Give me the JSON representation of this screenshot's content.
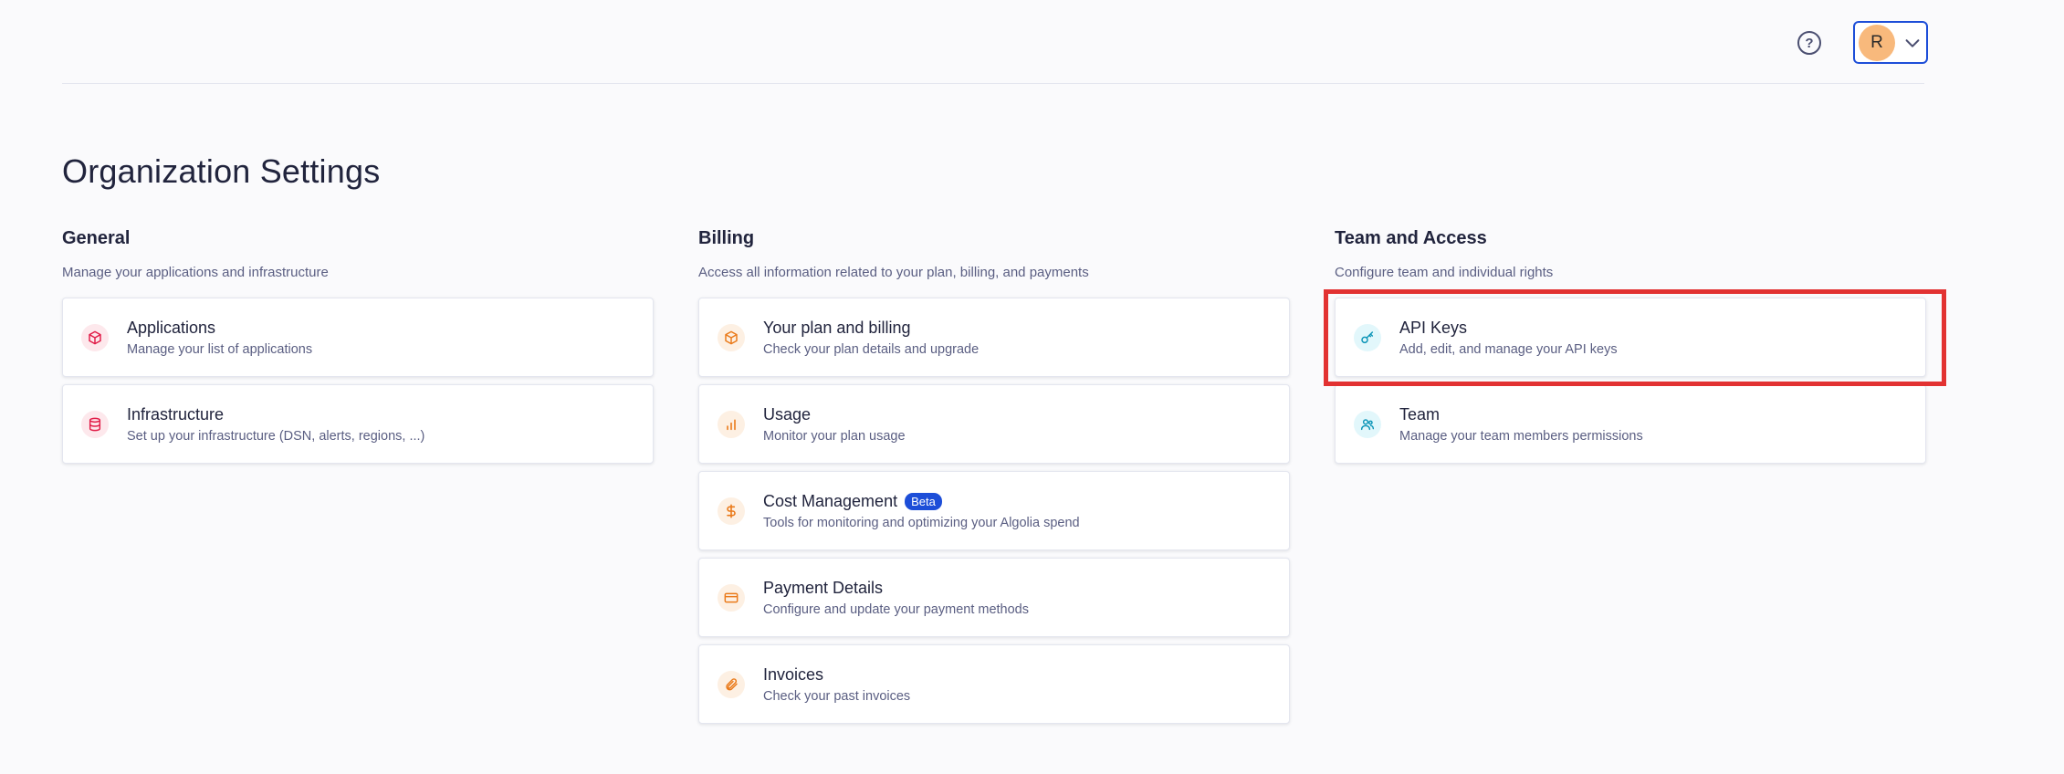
{
  "header": {
    "help_icon_glyph": "?",
    "user": {
      "initial": "R"
    }
  },
  "page_title": "Organization Settings",
  "sections": {
    "general": {
      "title": "General",
      "description": "Manage your applications and infrastructure",
      "items": [
        {
          "title": "Applications",
          "subtitle": "Manage your list of applications",
          "icon": "cube-icon"
        },
        {
          "title": "Infrastructure",
          "subtitle": "Set up your infrastructure (DSN, alerts, regions, ...)",
          "icon": "database-icon"
        }
      ]
    },
    "billing": {
      "title": "Billing",
      "description": "Access all information related to your plan, billing, and payments",
      "items": [
        {
          "title": "Your plan and billing",
          "subtitle": "Check your plan details and upgrade",
          "icon": "box-icon"
        },
        {
          "title": "Usage",
          "subtitle": "Monitor your plan usage",
          "icon": "bar-chart-icon"
        },
        {
          "title": "Cost Management",
          "badge": "Beta",
          "subtitle": "Tools for monitoring and optimizing your Algolia spend",
          "icon": "dollar-icon"
        },
        {
          "title": "Payment Details",
          "subtitle": "Configure and update your payment methods",
          "icon": "credit-card-icon"
        },
        {
          "title": "Invoices",
          "subtitle": "Check your past invoices",
          "icon": "paperclip-icon"
        }
      ]
    },
    "team_access": {
      "title": "Team and Access",
      "description": "Configure team and individual rights",
      "items": [
        {
          "title": "API Keys",
          "subtitle": "Add, edit, and manage your API keys",
          "icon": "key-icon"
        },
        {
          "title": "Team",
          "subtitle": "Manage your team members permissions",
          "icon": "users-icon"
        }
      ]
    }
  },
  "colors": {
    "accent": "#1d4ed8",
    "highlight": "#e23232",
    "avatar": "#f8b97c"
  }
}
